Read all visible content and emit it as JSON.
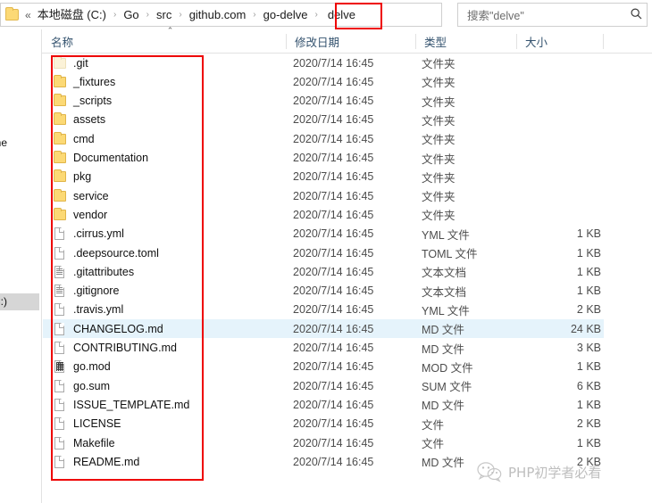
{
  "address_bar": {
    "back_chevron": "«",
    "breadcrumbs": [
      {
        "label": "本地磁盘 (C:)"
      },
      {
        "label": "Go"
      },
      {
        "label": "src"
      },
      {
        "label": "github.com"
      },
      {
        "label": "go-delve"
      },
      {
        "label": "delve",
        "highlighted": true
      }
    ],
    "separator": "›",
    "dropdown_icon": "⌄",
    "refresh_icon": "↻"
  },
  "search": {
    "placeholder": "搜索\"delve\"",
    "icon": "search-icon"
  },
  "sidebar": {
    "fragment_top": "one",
    "fragment_bottom": "(C:)"
  },
  "columns": {
    "sort_caret": "⌃",
    "headers": [
      {
        "label": "名称"
      },
      {
        "label": "修改日期"
      },
      {
        "label": "类型"
      },
      {
        "label": "大小"
      }
    ]
  },
  "annotation": {
    "color": "#ee0000",
    "path_box_label": "delve",
    "list_box_label": "file-list"
  },
  "watermark": {
    "text": "PHP初学者必看",
    "logo": "wechat-icon"
  },
  "files": [
    {
      "name": ".git",
      "date": "2020/7/14 16:45",
      "type": "文件夹",
      "size": "",
      "icon": "folder-hidden-icon",
      "selected": false
    },
    {
      "name": "_fixtures",
      "date": "2020/7/14 16:45",
      "type": "文件夹",
      "size": "",
      "icon": "folder-icon",
      "selected": false
    },
    {
      "name": "_scripts",
      "date": "2020/7/14 16:45",
      "type": "文件夹",
      "size": "",
      "icon": "folder-icon",
      "selected": false
    },
    {
      "name": "assets",
      "date": "2020/7/14 16:45",
      "type": "文件夹",
      "size": "",
      "icon": "folder-icon",
      "selected": false
    },
    {
      "name": "cmd",
      "date": "2020/7/14 16:45",
      "type": "文件夹",
      "size": "",
      "icon": "folder-icon",
      "selected": false
    },
    {
      "name": "Documentation",
      "date": "2020/7/14 16:45",
      "type": "文件夹",
      "size": "",
      "icon": "folder-icon",
      "selected": false
    },
    {
      "name": "pkg",
      "date": "2020/7/14 16:45",
      "type": "文件夹",
      "size": "",
      "icon": "folder-icon",
      "selected": false
    },
    {
      "name": "service",
      "date": "2020/7/14 16:45",
      "type": "文件夹",
      "size": "",
      "icon": "folder-icon",
      "selected": false
    },
    {
      "name": "vendor",
      "date": "2020/7/14 16:45",
      "type": "文件夹",
      "size": "",
      "icon": "folder-icon",
      "selected": false
    },
    {
      "name": ".cirrus.yml",
      "date": "2020/7/14 16:45",
      "type": "YML 文件",
      "size": "1 KB",
      "icon": "file-icon",
      "selected": false
    },
    {
      "name": ".deepsource.toml",
      "date": "2020/7/14 16:45",
      "type": "TOML 文件",
      "size": "1 KB",
      "icon": "file-icon",
      "selected": false
    },
    {
      "name": ".gitattributes",
      "date": "2020/7/14 16:45",
      "type": "文本文档",
      "size": "1 KB",
      "icon": "text-file-icon",
      "selected": false
    },
    {
      "name": ".gitignore",
      "date": "2020/7/14 16:45",
      "type": "文本文档",
      "size": "1 KB",
      "icon": "text-file-icon",
      "selected": false
    },
    {
      "name": ".travis.yml",
      "date": "2020/7/14 16:45",
      "type": "YML 文件",
      "size": "2 KB",
      "icon": "file-icon",
      "selected": false
    },
    {
      "name": "CHANGELOG.md",
      "date": "2020/7/14 16:45",
      "type": "MD 文件",
      "size": "24 KB",
      "icon": "file-icon",
      "selected": true
    },
    {
      "name": "CONTRIBUTING.md",
      "date": "2020/7/14 16:45",
      "type": "MD 文件",
      "size": "3 KB",
      "icon": "file-icon",
      "selected": false
    },
    {
      "name": "go.mod",
      "date": "2020/7/14 16:45",
      "type": "MOD 文件",
      "size": "1 KB",
      "icon": "binary-file-icon",
      "selected": false
    },
    {
      "name": "go.sum",
      "date": "2020/7/14 16:45",
      "type": "SUM 文件",
      "size": "6 KB",
      "icon": "file-icon",
      "selected": false
    },
    {
      "name": "ISSUE_TEMPLATE.md",
      "date": "2020/7/14 16:45",
      "type": "MD 文件",
      "size": "1 KB",
      "icon": "file-icon",
      "selected": false
    },
    {
      "name": "LICENSE",
      "date": "2020/7/14 16:45",
      "type": "文件",
      "size": "2 KB",
      "icon": "file-icon",
      "selected": false
    },
    {
      "name": "Makefile",
      "date": "2020/7/14 16:45",
      "type": "文件",
      "size": "1 KB",
      "icon": "file-icon",
      "selected": false
    },
    {
      "name": "README.md",
      "date": "2020/7/14 16:45",
      "type": "MD 文件",
      "size": "2 KB",
      "icon": "file-icon",
      "selected": false
    }
  ]
}
